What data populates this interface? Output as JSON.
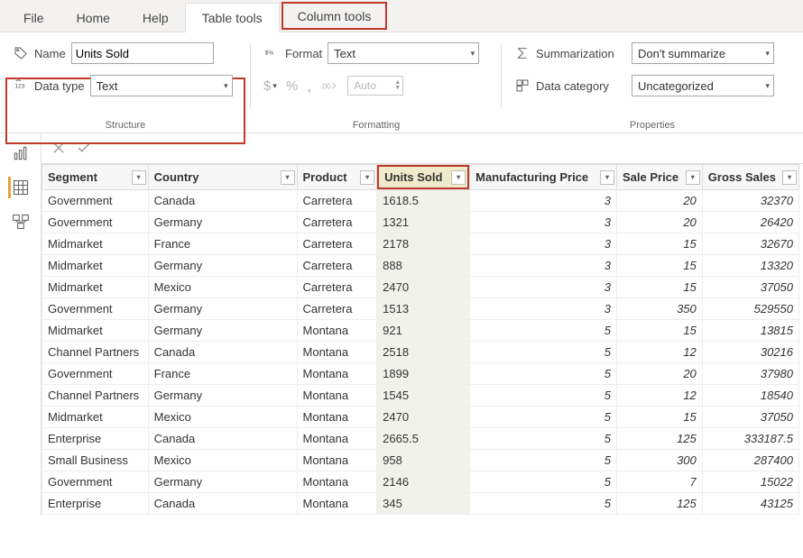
{
  "tabs": {
    "file": "File",
    "home": "Home",
    "help": "Help",
    "table_tools": "Table tools",
    "column_tools": "Column tools"
  },
  "structure": {
    "name_label": "Name",
    "name_value": "Units Sold",
    "datatype_label": "Data type",
    "datatype_value": "Text",
    "group_label": "Structure"
  },
  "formatting": {
    "format_label": "Format",
    "format_value": "Text",
    "auto": "Auto",
    "group_label": "Formatting",
    "currency": "$",
    "percent": "%",
    "comma": ",",
    "dec": ".00"
  },
  "properties": {
    "summ_label": "Summarization",
    "summ_value": "Don't summarize",
    "cat_label": "Data category",
    "cat_value": "Uncategorized",
    "group_label": "Properties"
  },
  "columns": {
    "segment": "Segment",
    "country": "Country",
    "product": "Product",
    "units": "Units Sold",
    "mfg": "Manufacturing Price",
    "sale": "Sale Price",
    "gross": "Gross Sales"
  },
  "rows": [
    {
      "segment": "Government",
      "country": "Canada",
      "product": "Carretera",
      "units": "1618.5",
      "mfg": "3",
      "sale": "20",
      "gross": "32370"
    },
    {
      "segment": "Government",
      "country": "Germany",
      "product": "Carretera",
      "units": "1321",
      "mfg": "3",
      "sale": "20",
      "gross": "26420"
    },
    {
      "segment": "Midmarket",
      "country": "France",
      "product": "Carretera",
      "units": "2178",
      "mfg": "3",
      "sale": "15",
      "gross": "32670"
    },
    {
      "segment": "Midmarket",
      "country": "Germany",
      "product": "Carretera",
      "units": "888",
      "mfg": "3",
      "sale": "15",
      "gross": "13320"
    },
    {
      "segment": "Midmarket",
      "country": "Mexico",
      "product": "Carretera",
      "units": "2470",
      "mfg": "3",
      "sale": "15",
      "gross": "37050"
    },
    {
      "segment": "Government",
      "country": "Germany",
      "product": "Carretera",
      "units": "1513",
      "mfg": "3",
      "sale": "350",
      "gross": "529550"
    },
    {
      "segment": "Midmarket",
      "country": "Germany",
      "product": "Montana",
      "units": "921",
      "mfg": "5",
      "sale": "15",
      "gross": "13815"
    },
    {
      "segment": "Channel Partners",
      "country": "Canada",
      "product": "Montana",
      "units": "2518",
      "mfg": "5",
      "sale": "12",
      "gross": "30216"
    },
    {
      "segment": "Government",
      "country": "France",
      "product": "Montana",
      "units": "1899",
      "mfg": "5",
      "sale": "20",
      "gross": "37980"
    },
    {
      "segment": "Channel Partners",
      "country": "Germany",
      "product": "Montana",
      "units": "1545",
      "mfg": "5",
      "sale": "12",
      "gross": "18540"
    },
    {
      "segment": "Midmarket",
      "country": "Mexico",
      "product": "Montana",
      "units": "2470",
      "mfg": "5",
      "sale": "15",
      "gross": "37050"
    },
    {
      "segment": "Enterprise",
      "country": "Canada",
      "product": "Montana",
      "units": "2665.5",
      "mfg": "5",
      "sale": "125",
      "gross": "333187.5"
    },
    {
      "segment": "Small Business",
      "country": "Mexico",
      "product": "Montana",
      "units": "958",
      "mfg": "5",
      "sale": "300",
      "gross": "287400"
    },
    {
      "segment": "Government",
      "country": "Germany",
      "product": "Montana",
      "units": "2146",
      "mfg": "5",
      "sale": "7",
      "gross": "15022"
    },
    {
      "segment": "Enterprise",
      "country": "Canada",
      "product": "Montana",
      "units": "345",
      "mfg": "5",
      "sale": "125",
      "gross": "43125"
    }
  ]
}
